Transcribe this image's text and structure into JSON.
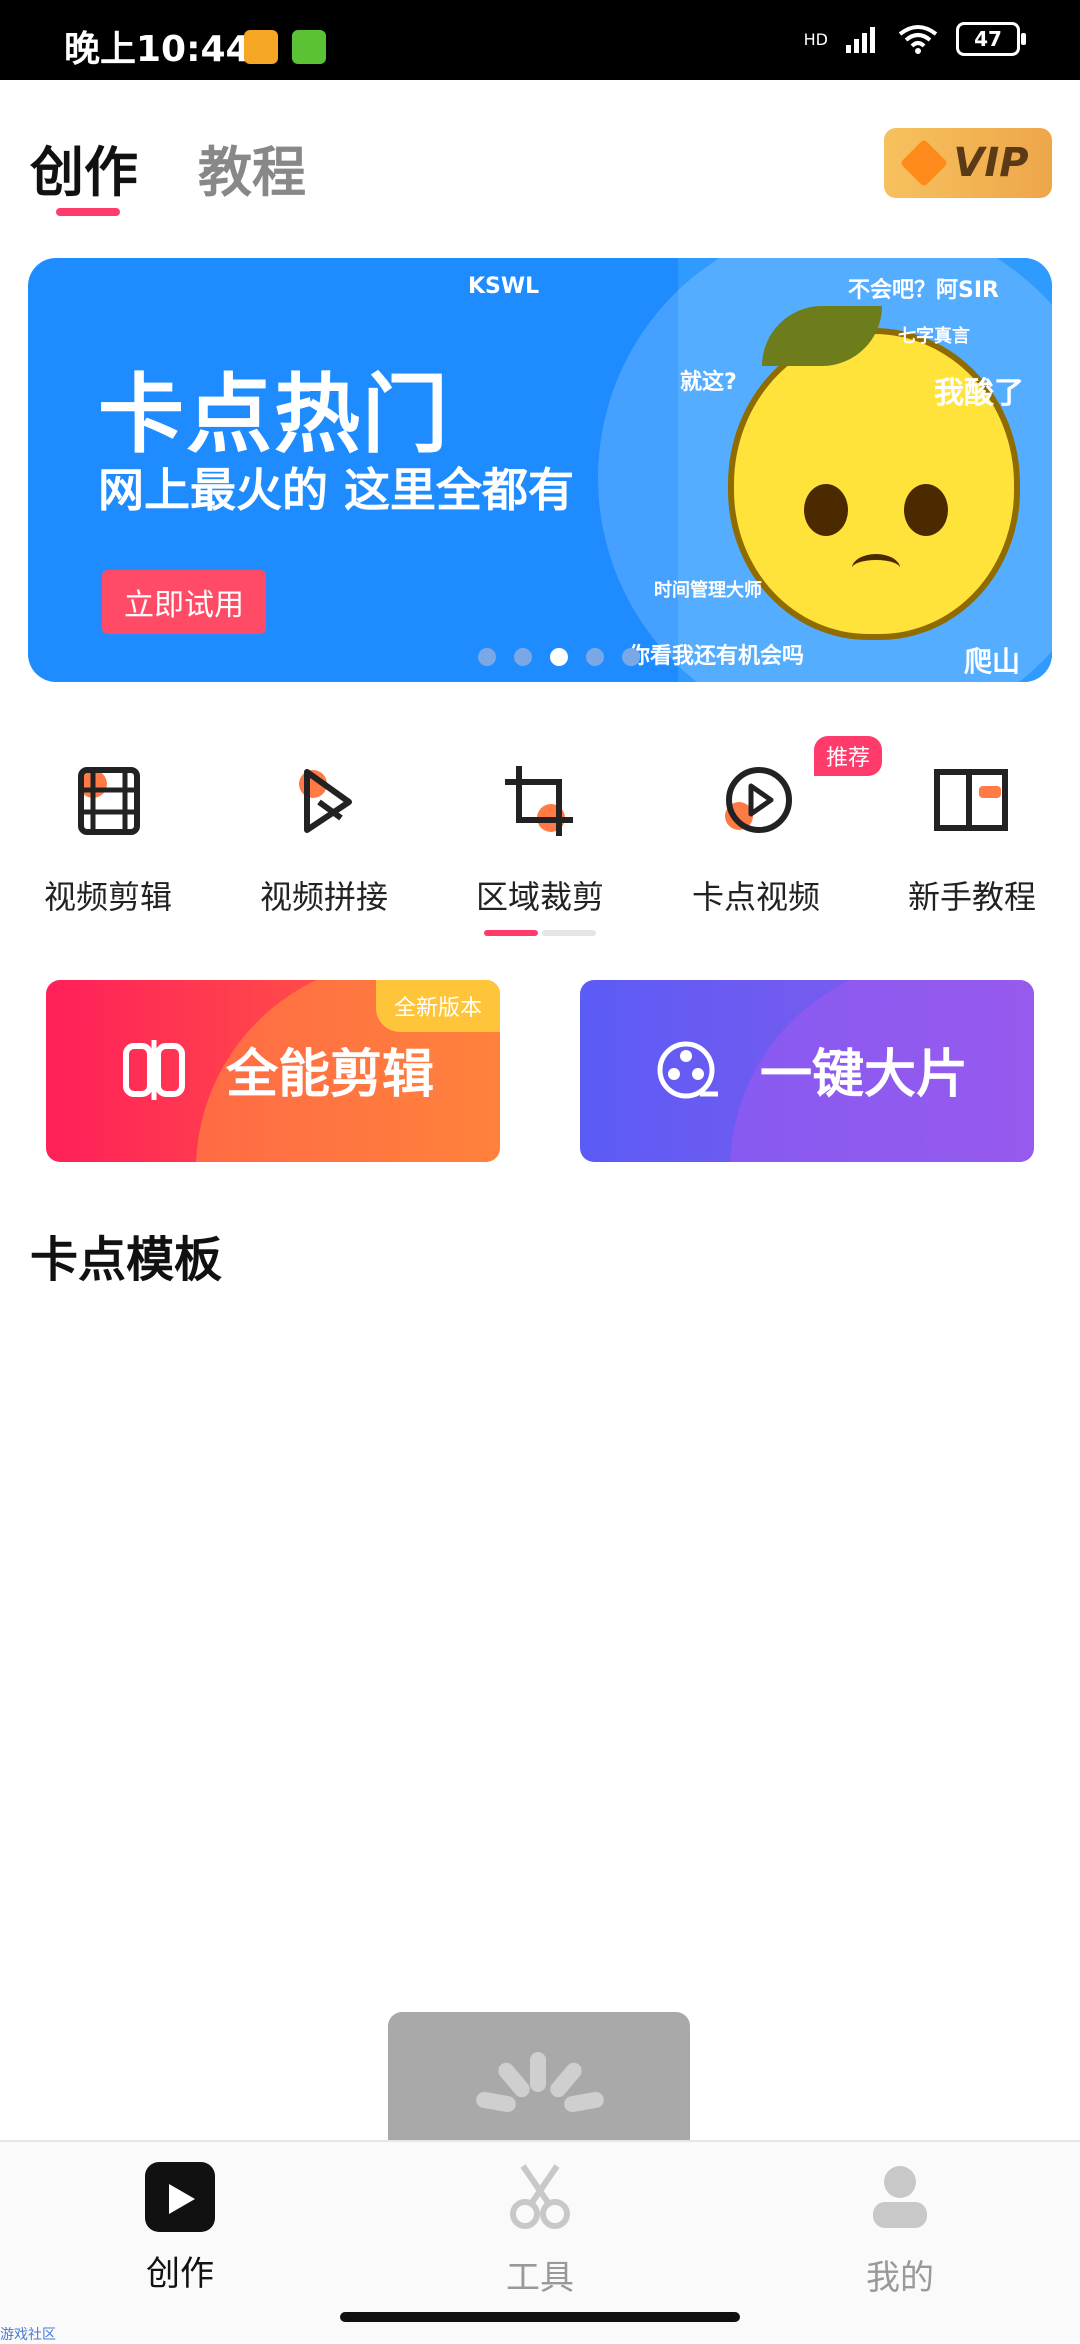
{
  "status_bar": {
    "time": "晚上10:44",
    "battery": "47",
    "signal_label": "HD"
  },
  "header": {
    "tabs": [
      {
        "label": "创作",
        "active": true
      },
      {
        "label": "教程",
        "active": false
      }
    ],
    "vip_label": "VIP"
  },
  "banner": {
    "headline": "卡点热门",
    "subline": "网上最火的 这里全都有",
    "button_label": "立即试用",
    "meme_texts": [
      "KSWL",
      "不会吧？阿SIR",
      "七字真言",
      "就这?",
      "我酸了",
      "时间管理大师",
      "你看我还有机会吗",
      "爬山"
    ],
    "page_count": 5,
    "active_page": 3
  },
  "tools": [
    {
      "label": "视频剪辑",
      "icon": "film-strip-icon"
    },
    {
      "label": "视频拼接",
      "icon": "play-join-icon"
    },
    {
      "label": "区域裁剪",
      "icon": "crop-icon"
    },
    {
      "label": "卡点视频",
      "icon": "play-circle-icon",
      "badge": "推荐"
    },
    {
      "label": "新手教程",
      "icon": "book-icon"
    }
  ],
  "feature_cards": [
    {
      "title": "全能剪辑",
      "badge": "全新版本",
      "icon": "split-edit-icon"
    },
    {
      "title": "一键大片",
      "icon": "film-reel-icon"
    }
  ],
  "section": {
    "title": "卡点模板"
  },
  "bottom_nav": [
    {
      "label": "创作",
      "icon": "clapper-icon",
      "active": true
    },
    {
      "label": "工具",
      "icon": "scissors-icon",
      "active": false
    },
    {
      "label": "我的",
      "icon": "profile-icon",
      "active": false
    }
  ],
  "watermark": "游戏社区",
  "colors": {
    "accent": "#ff3b6c",
    "banner_blue": "#1e8cff",
    "card1_gradient": [
      "#ff1f5a",
      "#ff6a3c"
    ],
    "card2_gradient": [
      "#5b5bf6",
      "#8b5be8"
    ],
    "vip_gold": "#f7c15d"
  }
}
